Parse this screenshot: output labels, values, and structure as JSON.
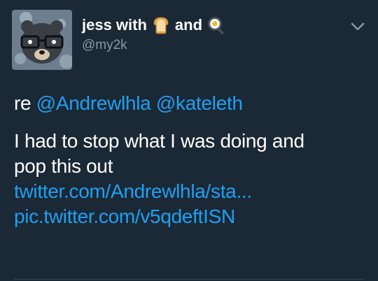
{
  "author": {
    "name_part1": "jess with",
    "name_part2": "and",
    "handle": "@my2k",
    "emoji1": "bread-emoji",
    "emoji2": "cooking-egg-emoji",
    "avatar": "bear-with-glasses-avatar"
  },
  "tweet": {
    "reply_prefix": "re",
    "mention1": "@Andrewlhla",
    "mention2": "@kateleth",
    "text_line1": "I had to stop what I was doing and",
    "text_line2": "pop this out",
    "link1": "twitter.com/Andrewlhla/sta...",
    "link2": "pic.twitter.com/v5qdeftISN"
  },
  "icons": {
    "menu": "chevron-down-icon"
  },
  "colors": {
    "background": "#1b2836",
    "link": "#1da1f2",
    "secondary_text": "#8899a6"
  }
}
